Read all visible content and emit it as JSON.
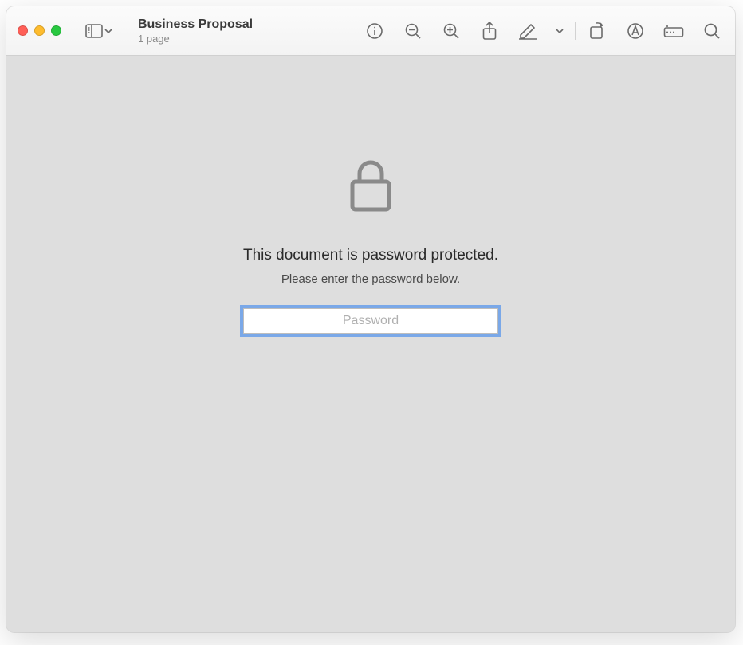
{
  "header": {
    "title": "Business Proposal",
    "subtitle": "1 page"
  },
  "content": {
    "heading": "This document is password protected.",
    "subtext": "Please enter the password below.",
    "password_placeholder": "Password",
    "password_value": ""
  }
}
